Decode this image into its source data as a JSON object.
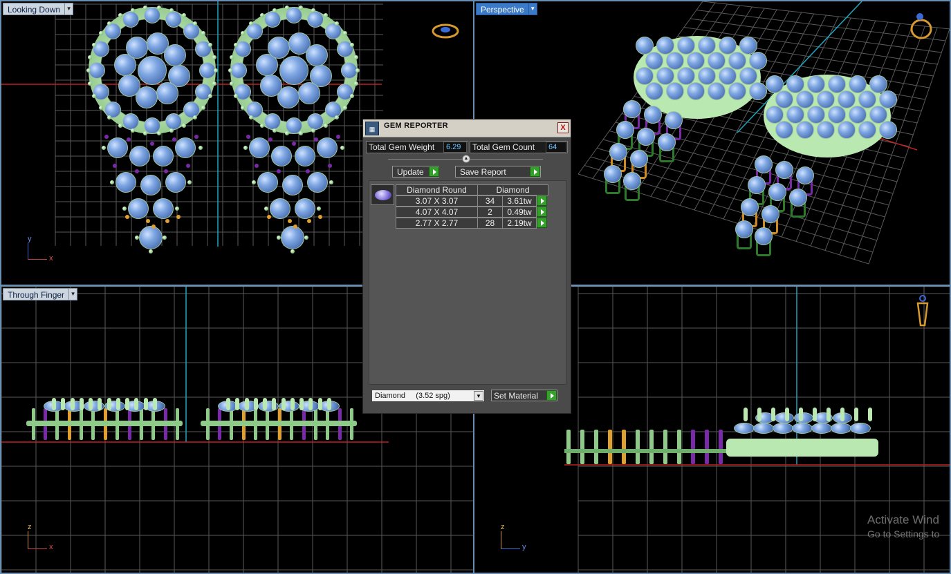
{
  "viewports": {
    "top_left": {
      "label": "Looking Down",
      "axes": {
        "v": "y",
        "h": "x"
      }
    },
    "top_right": {
      "label": "Perspective"
    },
    "bottom_left": {
      "label": "Through Finger",
      "axes": {
        "v": "z",
        "h": "x"
      }
    },
    "bottom_right": {
      "axes": {
        "v": "z",
        "h": "y"
      }
    }
  },
  "dialog": {
    "title": "GEM REPORTER",
    "close": "X",
    "total_weight_label": "Total Gem Weight",
    "total_weight_value": "6.29",
    "total_count_label": "Total Gem Count",
    "total_count_value": "64",
    "update_label": "Update",
    "save_label": "Save Report",
    "table": {
      "headers": [
        "Diamond Round",
        "Diamond"
      ],
      "rows": [
        {
          "size": "3.07 X 3.07",
          "count": "34",
          "weight": "3.61tw"
        },
        {
          "size": "4.07 X 4.07",
          "count": "2",
          "weight": "0.49tw"
        },
        {
          "size": "2.77 X 2.77",
          "count": "28",
          "weight": "2.19tw"
        }
      ]
    },
    "material_select": "Diamond     (3.52 spg)",
    "set_material_label": "Set Material"
  },
  "watermark": {
    "line1": "Activate Wind",
    "line2": "Go to Settings to"
  },
  "colors": {
    "viewport_bg": "#000000",
    "grid": "#5a5a5a",
    "axis_cyan": "#1ea6c0",
    "axis_red": "#c02020",
    "gem": "#7ea6e2",
    "metal_green": "#8ecb89",
    "prong_purple": "#7a2aa8",
    "prong_orange": "#e0a030"
  }
}
